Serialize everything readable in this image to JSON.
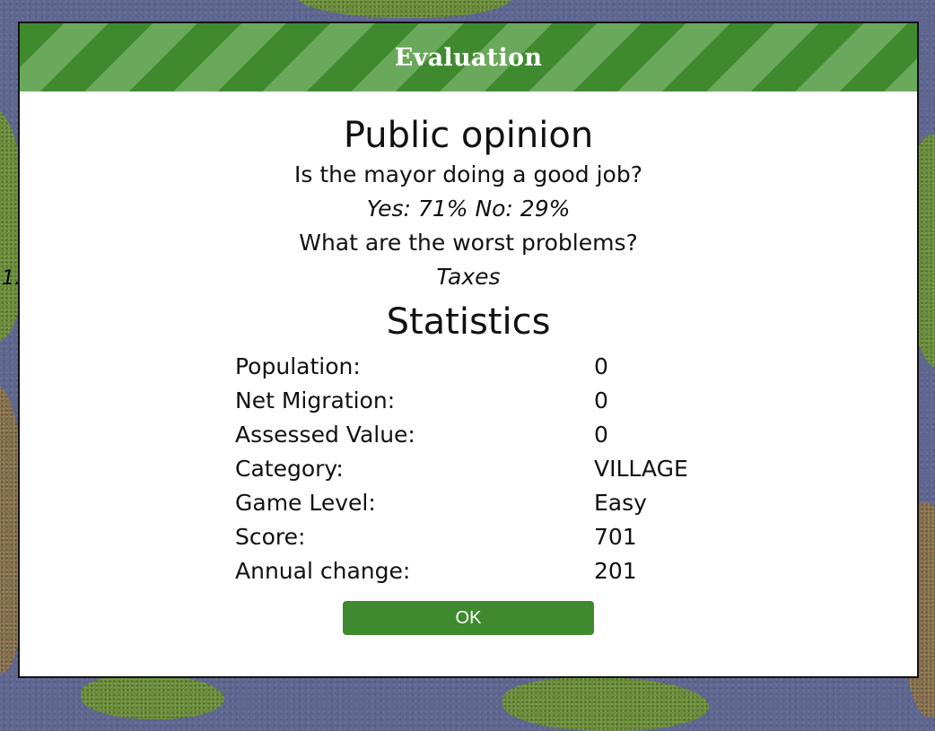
{
  "dialog": {
    "title": "Evaluation"
  },
  "opinion": {
    "title": "Public opinion",
    "question": "Is the mayor doing a good job?",
    "answer": "Yes: 71% No: 29%",
    "problems_question": "What are the worst problems?",
    "problems_answer": "Taxes"
  },
  "statistics": {
    "title": "Statistics",
    "rows": [
      {
        "label": "Population:",
        "value": "0"
      },
      {
        "label": "Net Migration:",
        "value": "0"
      },
      {
        "label": "Assessed Value:",
        "value": "0"
      },
      {
        "label": "Category:",
        "value": "VILLAGE"
      },
      {
        "label": "Game Level:",
        "value": "Easy"
      },
      {
        "label": "Score:",
        "value": "701"
      },
      {
        "label": "Annual change:",
        "value": "201"
      }
    ]
  },
  "buttons": {
    "ok": "OK"
  },
  "background": {
    "stray_text": "1."
  },
  "colors": {
    "header_green": "#3f8a2f",
    "header_stripe": "#6aa95c",
    "button_green": "#3f8a2f",
    "water": "#5f6690",
    "land": "#6b8a3c"
  }
}
